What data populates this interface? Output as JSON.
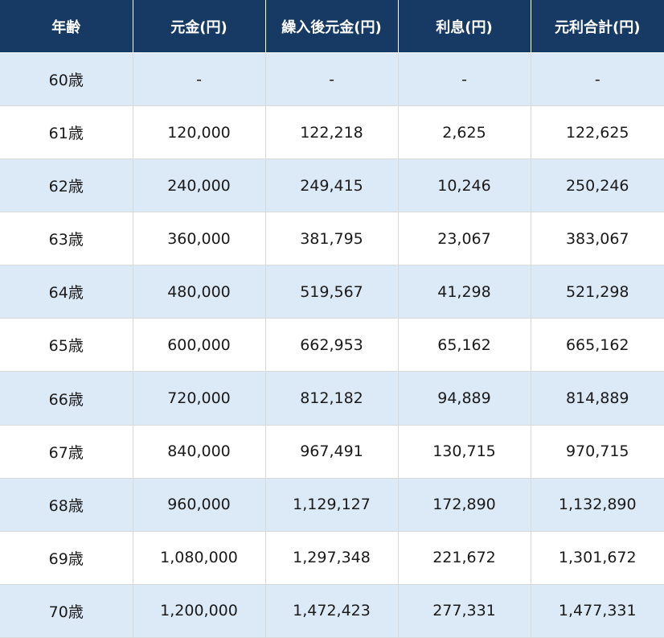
{
  "table": {
    "headers": [
      "年齢",
      "元金(円)",
      "繰入後元金(円)",
      "利息(円)",
      "元利合計(円)"
    ],
    "rows": [
      [
        "60歳",
        "-",
        "-",
        "-",
        "-"
      ],
      [
        "61歳",
        "120,000",
        "122,218",
        "2,625",
        "122,625"
      ],
      [
        "62歳",
        "240,000",
        "249,415",
        "10,246",
        "250,246"
      ],
      [
        "63歳",
        "360,000",
        "381,795",
        "23,067",
        "383,067"
      ],
      [
        "64歳",
        "480,000",
        "519,567",
        "41,298",
        "521,298"
      ],
      [
        "65歳",
        "600,000",
        "662,953",
        "65,162",
        "665,162"
      ],
      [
        "66歳",
        "720,000",
        "812,182",
        "94,889",
        "814,889"
      ],
      [
        "67歳",
        "840,000",
        "967,491",
        "130,715",
        "970,715"
      ],
      [
        "68歳",
        "960,000",
        "1,129,127",
        "172,890",
        "1,132,890"
      ],
      [
        "69歳",
        "1,080,000",
        "1,297,348",
        "221,672",
        "1,301,672"
      ],
      [
        "70歳",
        "1,200,000",
        "1,472,423",
        "277,331",
        "1,477,331"
      ]
    ]
  },
  "colors": {
    "header_bg": "#173a64",
    "header_text": "#ffffff",
    "row_alt_bg": "#dce9f7",
    "row_bg": "#ffffff",
    "border": "#d9d9d9"
  }
}
